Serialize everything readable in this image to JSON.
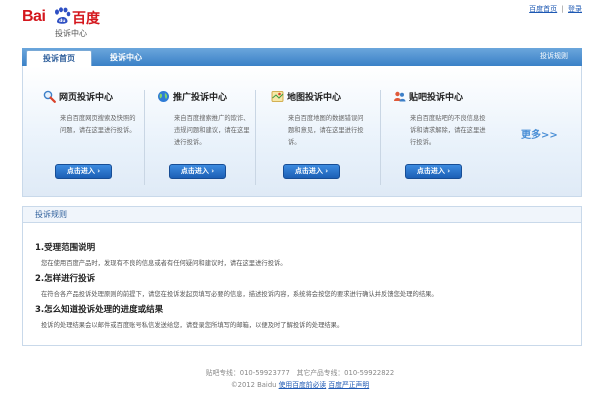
{
  "logo": {
    "brand_latin": "Bai",
    "brand_cn": "百度",
    "subtitle": "投诉中心"
  },
  "top_links": {
    "home": "百度首页",
    "separator": "|",
    "login": "登录"
  },
  "nav": {
    "tab_home": "投诉首页",
    "tab_center": "投诉中心",
    "rules_link": "投诉规则"
  },
  "cards": [
    {
      "title": "网页投诉中心",
      "desc": "来自百度网页搜索及快照的问题，请在这里进行投诉。",
      "button": "点击进入",
      "icon": "magnifier-icon"
    },
    {
      "title": "推广投诉中心",
      "desc": "来自百度搜索推广的欺诈、违规问题和建议，请在这里进行投诉。",
      "button": "点击进入",
      "icon": "globe-icon"
    },
    {
      "title": "地图投诉中心",
      "desc": "来自百度地图的数据错误问题和意见，请在这里进行投诉。",
      "button": "点击进入",
      "icon": "map-icon"
    },
    {
      "title": "贴吧投诉中心",
      "desc": "来自百度贴吧的不良信息投诉和请求解除，请在这里进行投诉。",
      "button": "点击进入",
      "icon": "people-icon"
    }
  ],
  "more": "更多>>",
  "rules": {
    "header": "投诉规则",
    "sections": [
      {
        "title": "1.受理范围说明",
        "text": "您在使用百度产品时，发现有不良的信息或者有任何疑问和建议时，请在这里进行投诉。"
      },
      {
        "title": "2.怎样进行投诉",
        "text": "在符合各产品投诉处理原则的前提下，请您在投诉发起页填写必要的信息，描述投诉内容，系统将会按您的要求进行确认并反馈您处理的结果。"
      },
      {
        "title": "3.怎么知道投诉处理的进度或结果",
        "text": "投诉的处理结果会以邮件或百度账号私信发送给您，请登录您所填写的邮箱，以便及时了解投诉的处理结果。"
      }
    ]
  },
  "footer": {
    "hotline": "贴吧专线：010-59923777　其它产品专线：010-59922822",
    "copyright": "©2012 Baidu",
    "link1": "使用百度前必读",
    "link2": "百度严正声明"
  },
  "colors": {
    "brand_red": "#d4161c",
    "nav_blue": "#3a81c7",
    "button_blue": "#1c5fb5",
    "link_blue": "#1d58b3"
  }
}
